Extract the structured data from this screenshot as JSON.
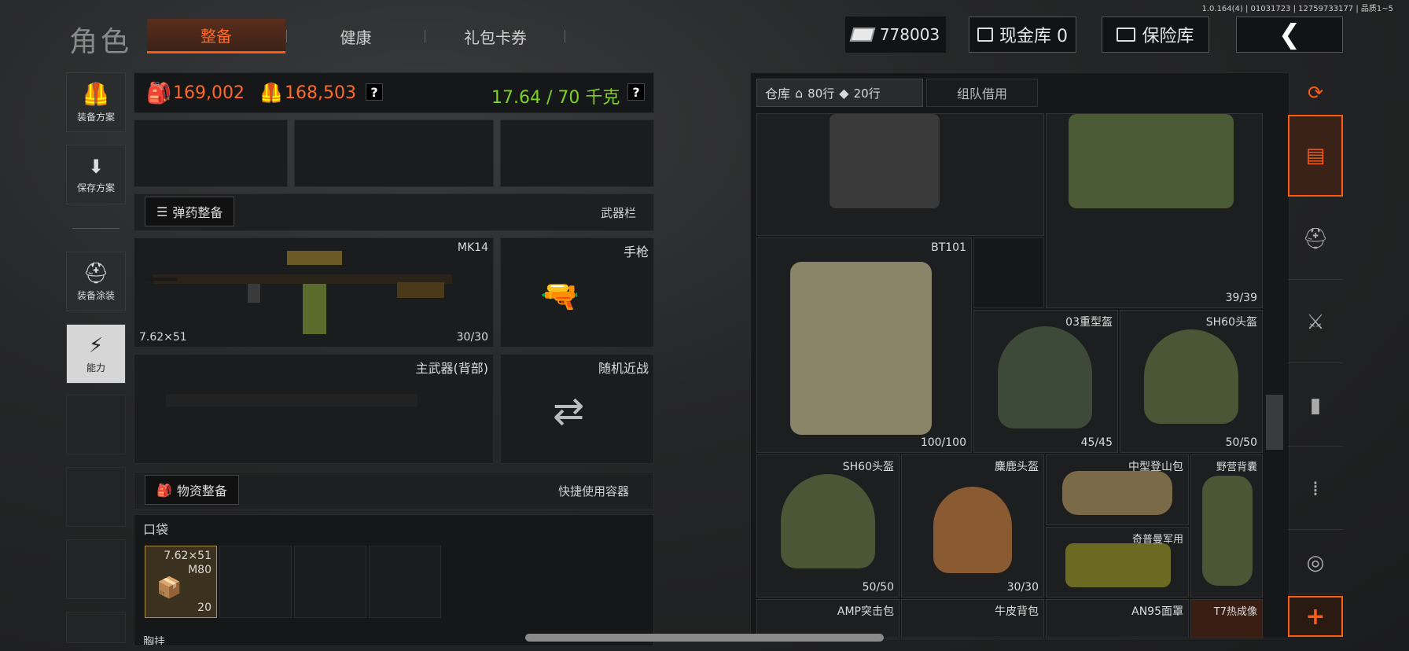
{
  "version": "1.0.164(4) | 01031723 | 12759733177 | 品质1~5",
  "title": "角色",
  "tabs": [
    {
      "label": "整备",
      "active": true
    },
    {
      "label": "健康",
      "active": false
    },
    {
      "label": "礼包卡券",
      "active": false
    }
  ],
  "currency": {
    "money": "778003",
    "cash_vault": "现金库 0",
    "insurance": "保险库"
  },
  "side_buttons": [
    "装备方案",
    "保存方案",
    "装备涂装",
    "能力"
  ],
  "stats": {
    "value1": "169,002",
    "value2": "168,503",
    "weight": "17.64 / 70 千克",
    "help": "?"
  },
  "ammo_section": {
    "button": "弹药整备",
    "label": "武器栏"
  },
  "weapons": {
    "primary": {
      "name": "MK14",
      "caliber": "7.62×51",
      "ammo": "30/30"
    },
    "pistol": "手枪",
    "back": "主武器(背部)",
    "melee": "随机近战"
  },
  "supply_section": {
    "button": "物资整备",
    "label": "快捷使用容器"
  },
  "pockets": {
    "label": "口袋",
    "item": {
      "caliber": "7.62×51",
      "name": "M80",
      "count": "20"
    },
    "partial_label": "胸挂"
  },
  "storage": {
    "tab_label": "仓库",
    "rows": "80行",
    "rows2": "20行",
    "team_borrow": "组队借用"
  },
  "storage_items": [
    {
      "name": "",
      "dur": ""
    },
    {
      "name": "",
      "dur": "39/39"
    },
    {
      "name": "BT101",
      "dur": "100/100"
    },
    {
      "name": "03重型盔",
      "dur": "45/45"
    },
    {
      "name": "SH60头盔",
      "dur": "50/50"
    },
    {
      "name": "SH60头盔",
      "dur": "50/50"
    },
    {
      "name": "麋鹿头盔",
      "dur": "30/30"
    },
    {
      "name": "中型登山包",
      "dur": ""
    },
    {
      "name": "野营背囊",
      "dur": ""
    },
    {
      "name": "奇普曼军用",
      "dur": ""
    },
    {
      "name": "AMP突击包",
      "dur": ""
    },
    {
      "name": "牛皮背包",
      "dur": ""
    },
    {
      "name": "AN95面罩",
      "dur": ""
    },
    {
      "name": "T7热成像",
      "dur": ""
    }
  ],
  "colors": {
    "accent": "#ff5a14",
    "weight": "#7ed321",
    "stat": "#ff6a2a"
  }
}
